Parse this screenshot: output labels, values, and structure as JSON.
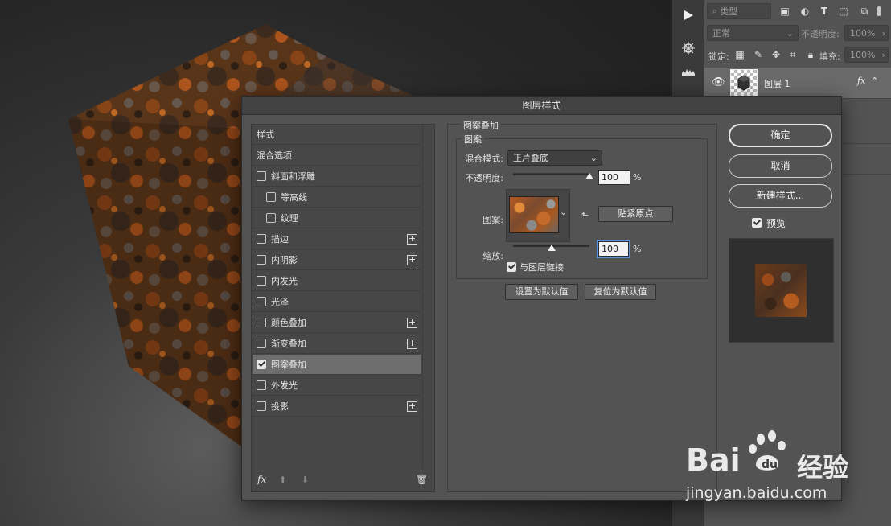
{
  "layers_panel": {
    "kind_filter": "类型",
    "blend_mode": "正常",
    "opacity_label": "不透明度:",
    "opacity_value": "100%",
    "lock_label": "锁定:",
    "fill_label": "填充:",
    "fill_value": "100%",
    "layer_name": "图层 1",
    "fx_badge": "fx"
  },
  "dialog": {
    "title": "图层样式",
    "style_list": {
      "items": [
        {
          "label": "样式",
          "checkbox": false,
          "checked": false,
          "plus": false,
          "indent": 0,
          "selected": false
        },
        {
          "label": "混合选项",
          "checkbox": false,
          "checked": false,
          "plus": false,
          "indent": 0,
          "selected": false
        },
        {
          "label": "斜面和浮雕",
          "checkbox": true,
          "checked": false,
          "plus": false,
          "indent": 0,
          "selected": false
        },
        {
          "label": "等高线",
          "checkbox": true,
          "checked": false,
          "plus": false,
          "indent": 1,
          "selected": false
        },
        {
          "label": "纹理",
          "checkbox": true,
          "checked": false,
          "plus": false,
          "indent": 1,
          "selected": false
        },
        {
          "label": "描边",
          "checkbox": true,
          "checked": false,
          "plus": true,
          "indent": 0,
          "selected": false
        },
        {
          "label": "内阴影",
          "checkbox": true,
          "checked": false,
          "plus": true,
          "indent": 0,
          "selected": false
        },
        {
          "label": "内发光",
          "checkbox": true,
          "checked": false,
          "plus": false,
          "indent": 0,
          "selected": false
        },
        {
          "label": "光泽",
          "checkbox": true,
          "checked": false,
          "plus": false,
          "indent": 0,
          "selected": false
        },
        {
          "label": "颜色叠加",
          "checkbox": true,
          "checked": false,
          "plus": true,
          "indent": 0,
          "selected": false
        },
        {
          "label": "渐变叠加",
          "checkbox": true,
          "checked": false,
          "plus": true,
          "indent": 0,
          "selected": false
        },
        {
          "label": "图案叠加",
          "checkbox": true,
          "checked": true,
          "plus": false,
          "indent": 0,
          "selected": true
        },
        {
          "label": "外发光",
          "checkbox": true,
          "checked": false,
          "plus": false,
          "indent": 0,
          "selected": false
        },
        {
          "label": "投影",
          "checkbox": true,
          "checked": false,
          "plus": true,
          "indent": 0,
          "selected": false
        }
      ],
      "footer_fx": "fx"
    },
    "pattern_overlay": {
      "section_title": "图案叠加",
      "group_title": "图案",
      "blend_mode_label": "混合模式:",
      "blend_mode_value": "正片叠底",
      "opacity_label": "不透明度:",
      "opacity_value": "100",
      "opacity_unit": "%",
      "opacity_level": 1.0,
      "pattern_label": "图案:",
      "snap_origin_button": "贴紧原点",
      "scale_label": "缩放:",
      "scale_value": "100",
      "scale_unit": "%",
      "scale_level": 0.5,
      "link_with_layer_label": "与图层链接",
      "link_with_layer_checked": true,
      "make_default_button": "设置为默认值",
      "reset_default_button": "复位为默认值"
    },
    "buttons": {
      "ok": "确定",
      "cancel": "取消",
      "new_style": "新建样式...",
      "preview_label": "预览",
      "preview_checked": true
    }
  },
  "watermark": {
    "brand": "Bai",
    "brand_tail": "经验",
    "url": "jingyan.baidu.com"
  },
  "colors": {
    "panel": "#535353",
    "rust_dark": "#4a2a12",
    "rust_orange": "#b8571c",
    "focus_blue": "#5b8ed6"
  }
}
